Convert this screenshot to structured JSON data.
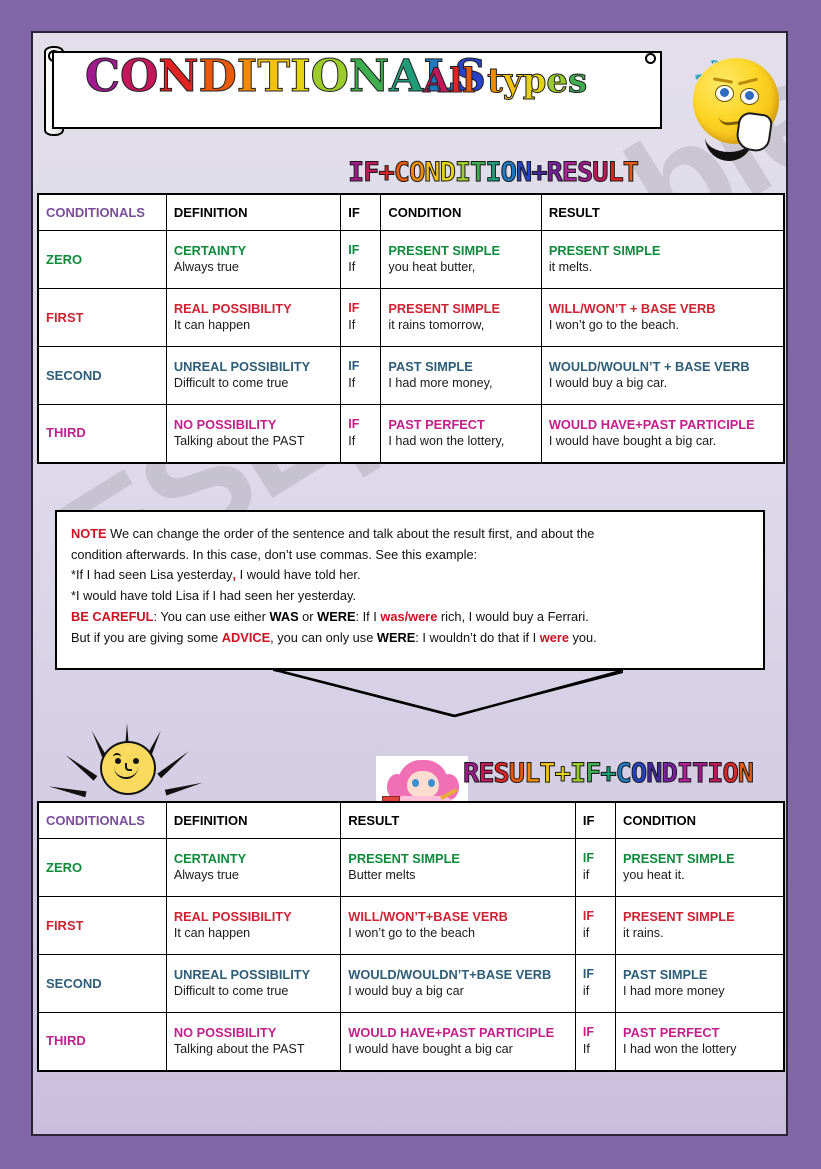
{
  "banner": {
    "title": "CONDITIONALS",
    "subtitle": "All types"
  },
  "sections": {
    "first_heading": "IF+CONDITION+RESULT",
    "second_heading": "RESULT+IF+CONDITION"
  },
  "table1": {
    "headers": [
      "CONDITIONALS",
      "DEFINITION",
      "IF",
      "CONDITION",
      "RESULT"
    ],
    "rows": [
      {
        "type": "ZERO",
        "color": "#0f8a3c",
        "definition_big": "CERTAINTY",
        "definition_small": "Always true",
        "if_big": "IF",
        "if_small": "If",
        "condition_big": "PRESENT SIMPLE",
        "condition_small": "you heat butter,",
        "result_big": "PRESENT SIMPLE",
        "result_small": "it melts."
      },
      {
        "type": "FIRST",
        "color": "#cf2233",
        "definition_big": "REAL POSSIBILITY",
        "definition_small": "It can happen",
        "if_big": "IF",
        "if_small": "If",
        "condition_big": "PRESENT SIMPLE",
        "condition_small": "it rains tomorrow,",
        "result_big": "WILL/WON’T + BASE VERB",
        "result_small": "I won’t go to the beach."
      },
      {
        "type": "SECOND",
        "color": "#2e5d77",
        "definition_big": "UNREAL POSSIBILITY",
        "definition_small": "Difficult to come true",
        "if_big": "IF",
        "if_small": "If",
        "condition_big": "PAST SIMPLE",
        "condition_small": "I had more money,",
        "result_big": "WOULD/WOULN’T + BASE VERB",
        "result_small": "I would buy a big car."
      },
      {
        "type": "THIRD",
        "color": "#c21f8a",
        "definition_big": "NO POSSIBILITY",
        "definition_small": "Talking about the PAST",
        "if_big": "IF",
        "if_small": "If",
        "condition_big": "PAST PERFECT",
        "condition_small": "I had won the lottery,",
        "result_big": "WOULD HAVE+PAST PARTICIPLE",
        "result_small": "I would have bought a big car."
      }
    ]
  },
  "table2": {
    "headers": [
      "CONDITIONALS",
      "DEFINITION",
      "RESULT",
      "IF",
      "CONDITION"
    ],
    "rows": [
      {
        "type": "ZERO",
        "color": "#0f8a3c",
        "definition_big": "CERTAINTY",
        "definition_small": "Always true",
        "result_big": "PRESENT SIMPLE",
        "result_small": "Butter melts",
        "if_big": "IF",
        "if_small": "if",
        "condition_big": "PRESENT SIMPLE",
        "condition_small": "you heat it."
      },
      {
        "type": "FIRST",
        "color": "#cf2233",
        "definition_big": "REAL POSSIBILITY",
        "definition_small": "It can happen",
        "result_big": "WILL/WON’T+BASE VERB",
        "result_small": "I won’t go to the beach",
        "if_big": "IF",
        "if_small": "if",
        "condition_big": "PRESENT SIMPLE",
        "condition_small": "it rains."
      },
      {
        "type": "SECOND",
        "color": "#2e5d77",
        "definition_big": "UNREAL POSSIBILITY",
        "definition_small": "Difficult to come true",
        "result_big": "WOULD/WOULDN’T+BASE VERB",
        "result_small": "I would buy a big car",
        "if_big": "IF",
        "if_small": "if",
        "condition_big": "PAST SIMPLE",
        "condition_small": "I had more money"
      },
      {
        "type": "THIRD",
        "color": "#c21f8a",
        "definition_big": "NO POSSIBILITY",
        "definition_small": "Talking about the PAST",
        "result_big": "WOULD HAVE+PAST PARTICIPLE",
        "result_small": "I would have bought a big car",
        "if_big": "IF",
        "if_small": "If",
        "condition_big": "PAST PERFECT",
        "condition_small": "I had won the lottery"
      }
    ]
  },
  "note": {
    "label": "NOTE",
    "line1": "We can change the order of the sentence and talk about the result first, and about  the",
    "line2": "condition afterwards. In this case, don’t use commas. See this example:",
    "example1_pre": "*If I had seen Lisa yesterday",
    "example1_comma": ",",
    "example1_post": " I would have told her.",
    "example2": "*I would have told Lisa if I had seen her yesterday.",
    "careful_label": "BE CAREFUL",
    "careful_a": ": You can use either ",
    "careful_was": "WAS",
    "careful_b": " or ",
    "careful_were": "WERE",
    "careful_c": ":  If I ",
    "careful_waswere": "was/were",
    "careful_d": " rich, I would buy a Ferrari.",
    "advice_a": "But if you are giving some ",
    "advice_label": "ADVICE",
    "advice_b": ", you can only use ",
    "advice_were": "WERE",
    "advice_c": ": I wouldn’t do that if I ",
    "advice_were2": "were",
    "advice_d": " you."
  },
  "watermark": "ESLprintables.com",
  "colors": {
    "page_border": "#8167a8",
    "zero": "#0f8a3c",
    "first": "#cf2233",
    "second": "#2e5d77",
    "third": "#c21f8a",
    "note_accent": "#cc1122",
    "header_conditionals": "#7a4d9c"
  }
}
